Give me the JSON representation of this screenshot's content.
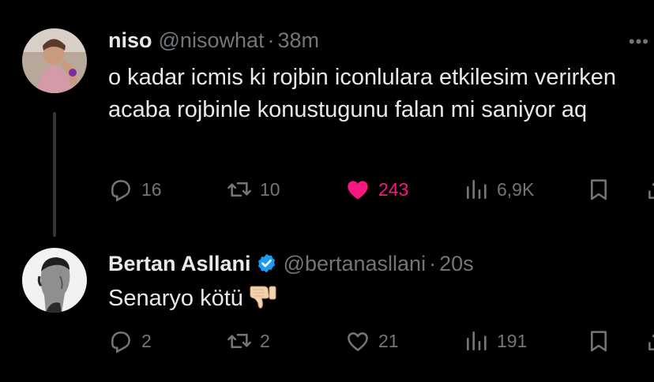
{
  "tweets": [
    {
      "name": "niso",
      "handle": "@nisowhat",
      "separator": "·",
      "time": "38m",
      "text": "o kadar icmis ki rojbin iconlulara etkilesim verirken acaba rojbinle konustugunu falan mi saniyor aq",
      "replies": "16",
      "retweets": "10",
      "likes": "243",
      "views": "6,9K",
      "liked": true
    },
    {
      "name": "Bertan Asllani",
      "handle": "@bertanasllani",
      "separator": "·",
      "time": "20s",
      "text": "Senaryo kötü",
      "emoji": "thumbs-down-emoji",
      "verified": true,
      "replies": "2",
      "retweets": "2",
      "likes": "21",
      "views": "191",
      "liked": false
    }
  ],
  "colors": {
    "background": "#000000",
    "text": "#e7e9ea",
    "muted": "#71767b",
    "like_active": "#f91880",
    "verified": "#1d9bf0"
  }
}
